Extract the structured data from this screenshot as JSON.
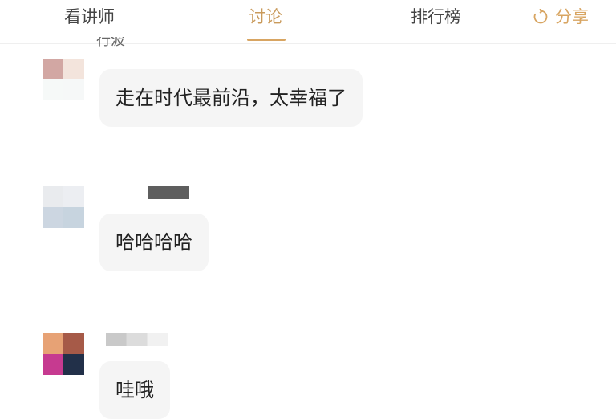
{
  "tabs": [
    {
      "label": "看讲师",
      "active": false
    },
    {
      "label": "讨论",
      "active": true
    },
    {
      "label": "排行榜",
      "active": false
    }
  ],
  "share": {
    "label": "分享",
    "icon": "refresh-share-icon"
  },
  "messages": [
    {
      "name_fragment": "行波",
      "text": "走在时代最前沿，太幸福了"
    },
    {
      "text": "哈哈哈哈"
    },
    {
      "text": "哇哦"
    }
  ],
  "colors": {
    "accent": "#c99a5b",
    "bubble": "#f5f5f5",
    "avatar1": [
      "#d2a7a3",
      "#f3e4dc",
      "#f6f9f8",
      "#f6f8f8"
    ],
    "avatar2": [
      "#e9ebee",
      "#eceef2",
      "#ccd6e1",
      "#c7d4df"
    ],
    "avatar3": [
      "#e7a275",
      "#a65a48",
      "#c63a90",
      "#223049"
    ]
  }
}
